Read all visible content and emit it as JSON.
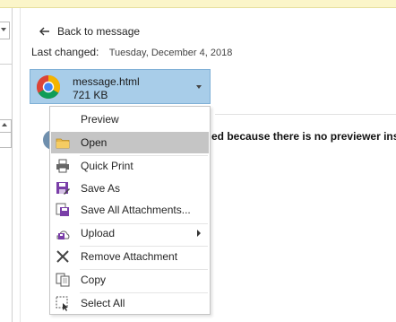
{
  "header": {
    "back_label": "Back to message",
    "last_changed_label": "Last changed:",
    "last_changed_value": "Tuesday, December 4, 2018"
  },
  "attachment": {
    "name": "message.html",
    "size": "721 KB",
    "icon": "chrome-icon"
  },
  "message": {
    "text": "ed because there is no previewer inst"
  },
  "menu": {
    "items": [
      {
        "label": "Preview",
        "icon": "none"
      },
      {
        "label": "Open",
        "icon": "folder-icon",
        "highlighted": true
      },
      {
        "label": "Quick Print",
        "icon": "printer-icon"
      },
      {
        "label": "Save As",
        "icon": "save-as-icon"
      },
      {
        "label": "Save All Attachments...",
        "icon": "save-all-icon"
      },
      {
        "label": "Upload",
        "icon": "upload-icon",
        "submenu": true
      },
      {
        "label": "Remove Attachment",
        "icon": "remove-icon"
      },
      {
        "label": "Copy",
        "icon": "copy-icon"
      },
      {
        "label": "Select All",
        "icon": "select-all-icon"
      }
    ]
  },
  "colors": {
    "attachment_bg": "#a8cde9",
    "menu_highlight": "#c5c5c5",
    "notification_bar": "#fbf5c9"
  }
}
